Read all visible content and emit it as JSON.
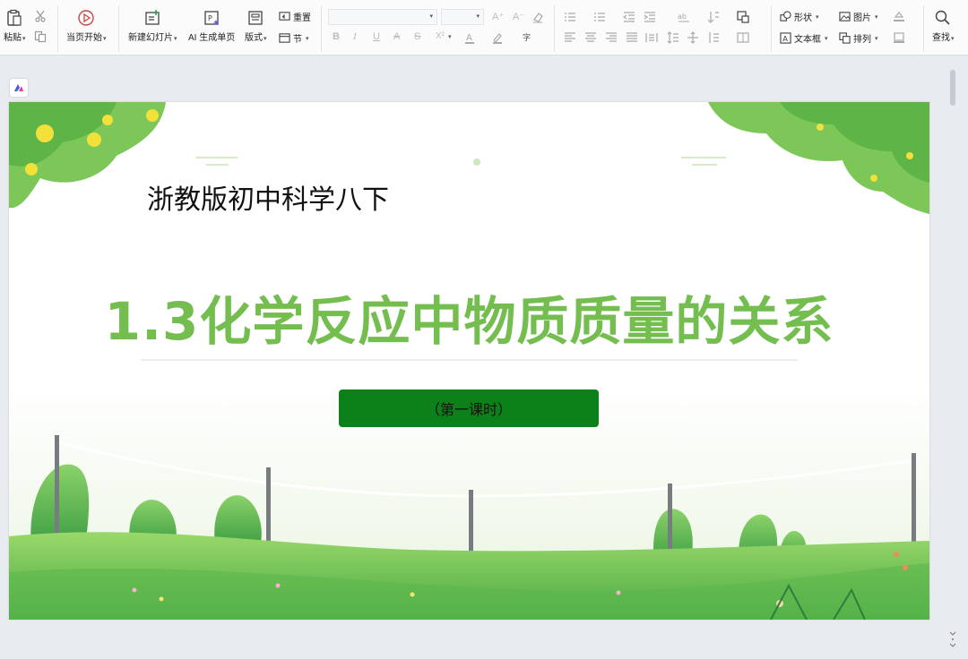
{
  "toolbar": {
    "paste": "粘贴",
    "from_current": "当页开始",
    "new_slide": "新建幻灯片",
    "ai_generate": "AI 生成单页",
    "layout": "版式",
    "reset": "重置",
    "section": "节",
    "shape": "形状",
    "picture": "图片",
    "textbox": "文本框",
    "arrange": "排列",
    "find": "查找",
    "bold": "B",
    "italic": "I",
    "underline": "U",
    "strike": "A",
    "shadow": "S",
    "superscript": "X²",
    "font_grow": "A⁺",
    "font_shrink": "A⁻"
  },
  "slide": {
    "subtitle": "浙教版初中科学八下",
    "title": "1.3化学反应中物质质量的关系",
    "lesson_button": "（第一课时）"
  },
  "colors": {
    "title_green": "#74bd4f",
    "button_green": "#0c8019",
    "ribbon_bg": "#fbfbfc"
  }
}
